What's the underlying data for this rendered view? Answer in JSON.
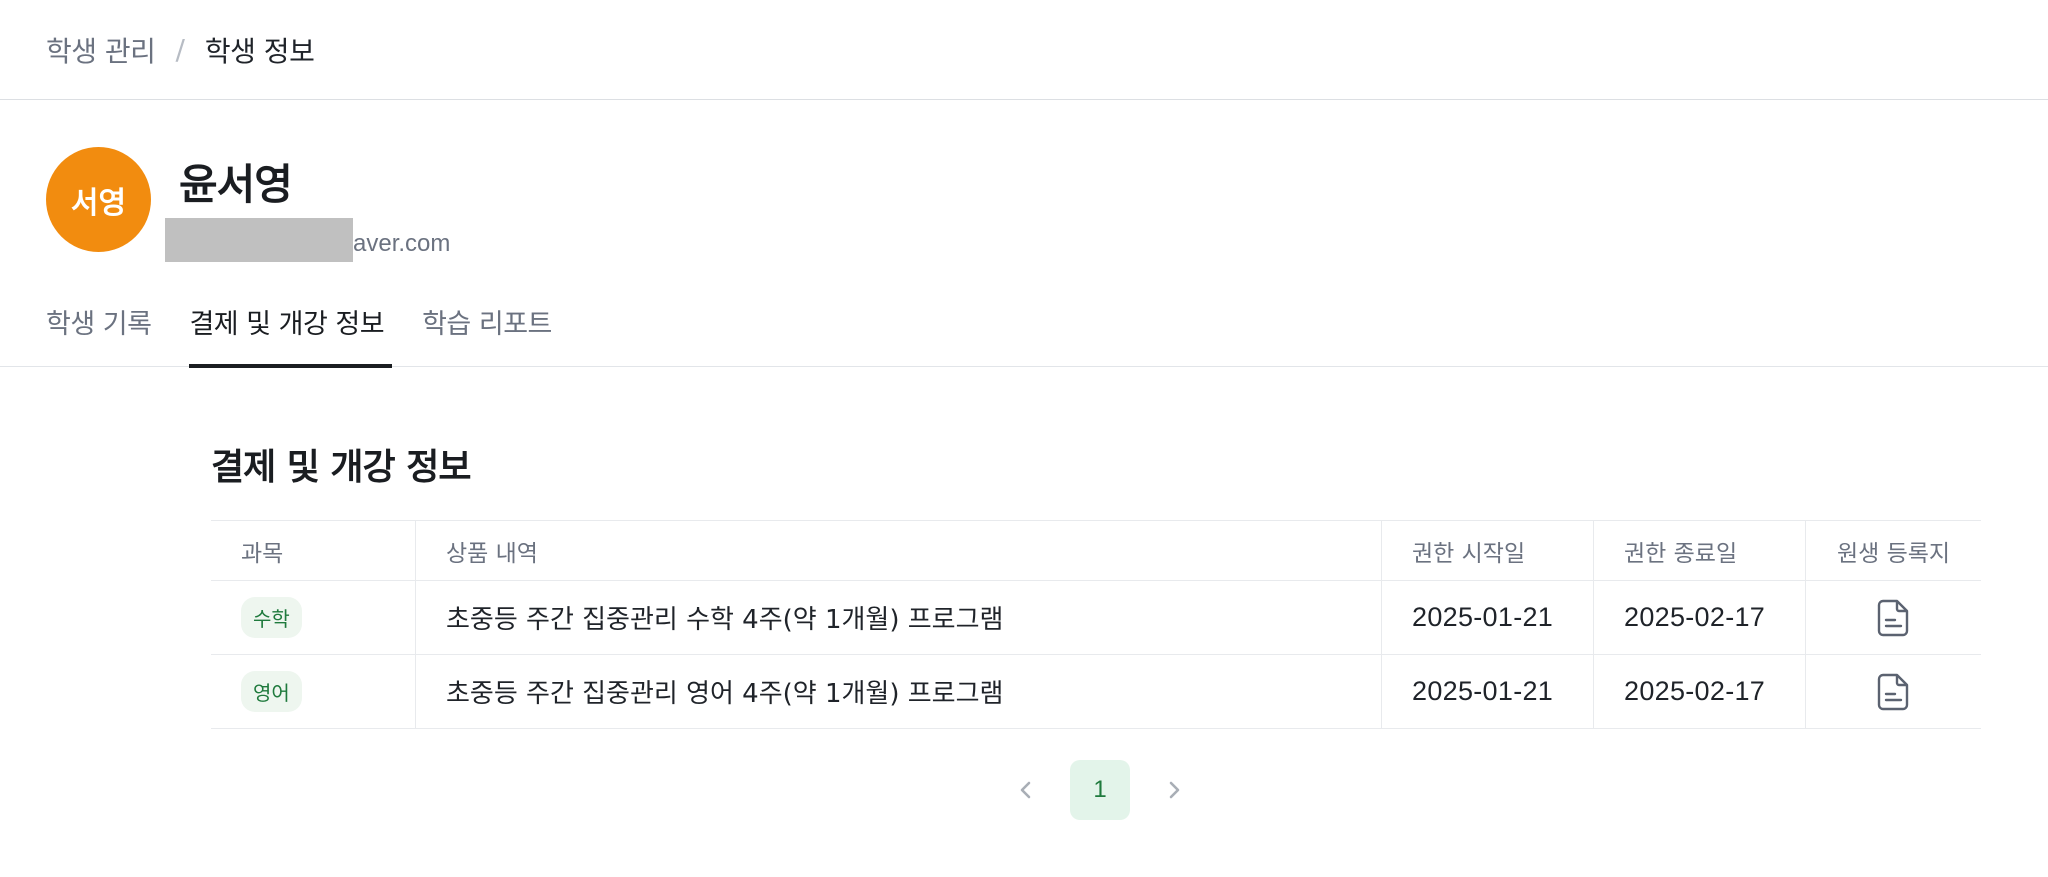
{
  "breadcrumb": {
    "parent": "학생 관리",
    "separator": "/",
    "current": "학생 정보"
  },
  "profile": {
    "avatar_text": "서영",
    "avatar_color": "#f28c0f",
    "name": "윤서영",
    "email_visible": "aver.com"
  },
  "tabs": [
    {
      "label": "학생 기록",
      "active": false
    },
    {
      "label": "결제 및 개강 정보",
      "active": true
    },
    {
      "label": "학습 리포트",
      "active": false
    }
  ],
  "section": {
    "title": "결제 및 개강 정보"
  },
  "table": {
    "headers": [
      "과목",
      "상품 내역",
      "권한 시작일",
      "권한 종료일",
      "원생 등록지"
    ],
    "rows": [
      {
        "subject": "수학",
        "product": "초중등 주간 집중관리 수학 4주(약 1개월) 프로그램",
        "start": "2025-01-21",
        "end": "2025-02-17",
        "doc_icon": "document-icon"
      },
      {
        "subject": "영어",
        "product": "초중등 주간 집중관리 영어 4주(약 1개월) 프로그램",
        "start": "2025-01-21",
        "end": "2025-02-17",
        "doc_icon": "document-icon"
      }
    ]
  },
  "pagination": {
    "current_page": "1",
    "prev_icon": "chevron-left-icon",
    "next_icon": "chevron-right-icon"
  },
  "colors": {
    "accent_green": "#1f7a3d",
    "badge_bg": "#eef6ef",
    "active_page_bg": "#e3f4ea"
  }
}
